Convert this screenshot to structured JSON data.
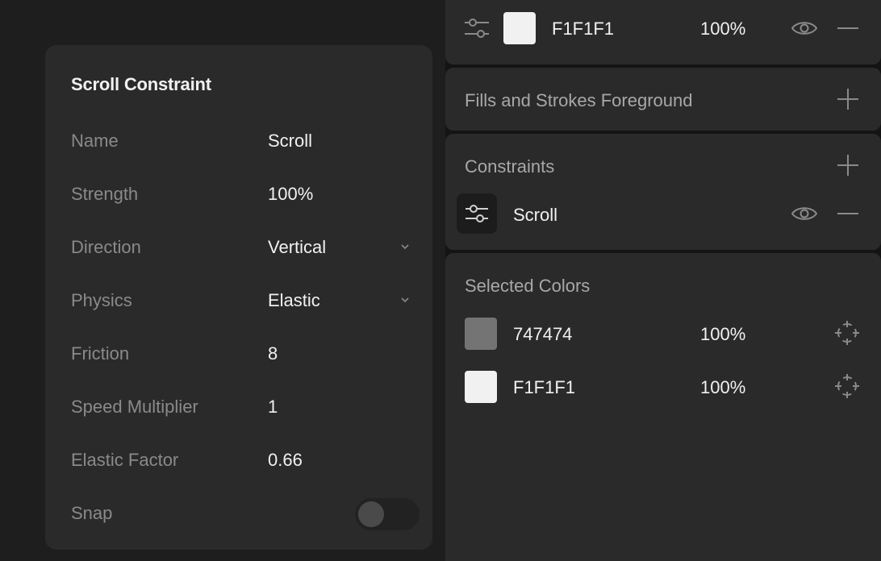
{
  "popover": {
    "title": "Scroll Constraint",
    "rows": [
      {
        "label": "Name",
        "value": "Scroll"
      },
      {
        "label": "Strength",
        "value": "100%"
      },
      {
        "label": "Direction",
        "value": "Vertical"
      },
      {
        "label": "Physics",
        "value": "Elastic"
      },
      {
        "label": "Friction",
        "value": "8"
      },
      {
        "label": "Speed Multiplier",
        "value": "1"
      },
      {
        "label": "Elastic Factor",
        "value": "0.66"
      },
      {
        "label": "Snap",
        "value": ""
      }
    ],
    "snap_on": false
  },
  "inspector": {
    "fill": {
      "hex": "F1F1F1",
      "opacity": "100%",
      "color": "#F1F1F1"
    },
    "fills_strokes_title": "Fills and Strokes Foreground",
    "constraints_title": "Constraints",
    "constraint_item": "Scroll",
    "selected_colors_title": "Selected Colors",
    "selected_colors": [
      {
        "hex": "747474",
        "opacity": "100%",
        "color": "#747474"
      },
      {
        "hex": "F1F1F1",
        "opacity": "100%",
        "color": "#F1F1F1"
      }
    ]
  }
}
